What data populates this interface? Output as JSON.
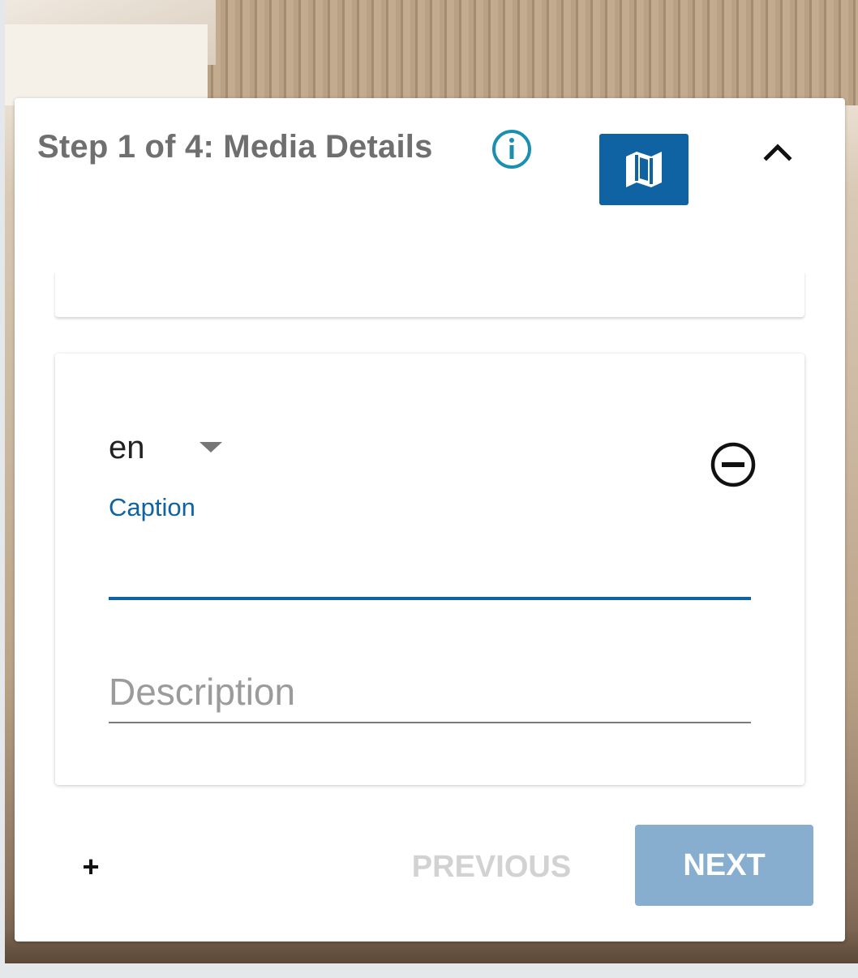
{
  "header": {
    "title": "Step 1 of 4: Media Details",
    "info_icon": "info-circle-icon",
    "map_icon": "map-icon",
    "collapse_icon": "chevron-up-icon"
  },
  "caption_entry": {
    "language": "en",
    "language_options": [
      "en"
    ],
    "caption_label": "Caption",
    "caption_value": "",
    "description_placeholder": "Description",
    "description_value": "",
    "remove_icon": "minus-circle-icon"
  },
  "footer": {
    "add_label": "+",
    "previous_label": "PREVIOUS",
    "next_label": "NEXT"
  },
  "colors": {
    "accent": "#0f63a3",
    "title_text": "#6f6f6f",
    "next_button_bg": "#87aecf",
    "previous_disabled_text": "#d2d2d2",
    "info_icon": "#1a8fb0"
  }
}
